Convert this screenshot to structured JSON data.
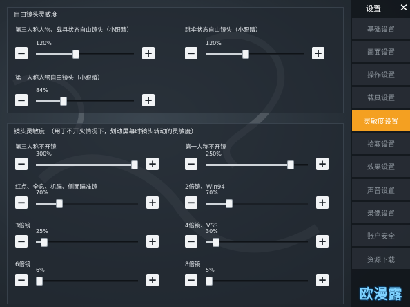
{
  "sidebar": {
    "title": "设置",
    "close_label": "✕",
    "items": [
      {
        "label": "基础设置",
        "active": false
      },
      {
        "label": "画面设置",
        "active": false
      },
      {
        "label": "操作设置",
        "active": false
      },
      {
        "label": "载具设置",
        "active": false
      },
      {
        "label": "灵敏度设置",
        "active": true
      },
      {
        "label": "拾取设置",
        "active": false
      },
      {
        "label": "效果设置",
        "active": false
      },
      {
        "label": "声音设置",
        "active": false
      },
      {
        "label": "录像设置",
        "active": false
      },
      {
        "label": "账户安全",
        "active": false
      },
      {
        "label": "资源下载",
        "active": false
      }
    ]
  },
  "free_camera": {
    "title": "自由镜头灵敏度",
    "sliders": [
      {
        "label": "第三人称人物、载具状态自由镜头（小眼睛）",
        "value_text": "120%",
        "fraction": 0.41
      },
      {
        "label": "跳伞状态自由镜头（小眼睛）",
        "value_text": "120%",
        "fraction": 0.41
      },
      {
        "label": "第一人称人物自由镜头（小眼睛）",
        "value_text": "84%",
        "fraction": 0.28
      }
    ]
  },
  "camera": {
    "title": "镜头灵敏度　（用于不开火情况下，划动屏幕时镜头转动的灵敏度）",
    "sliders": [
      {
        "label": "第三人称不开镜",
        "value_text": "300%",
        "fraction": 1.0
      },
      {
        "label": "第一人称不开镜",
        "value_text": "250%",
        "fraction": 0.83
      },
      {
        "label": "红点、全息、机瞄、侧面瞄准镜",
        "value_text": "70%",
        "fraction": 0.23
      },
      {
        "label": "2倍镜、Win94",
        "value_text": "70%",
        "fraction": 0.23
      },
      {
        "label": "3倍镜",
        "value_text": "25%",
        "fraction": 0.08
      },
      {
        "label": "4倍镜、VSS",
        "value_text": "30%",
        "fraction": 0.1
      },
      {
        "label": "6倍镜",
        "value_text": "6%",
        "fraction": 0.02
      },
      {
        "label": "8倍镜",
        "value_text": "5%",
        "fraction": 0.02
      }
    ]
  },
  "buttons": {
    "minus": "−",
    "plus": "+"
  },
  "watermark": "欧漫露"
}
